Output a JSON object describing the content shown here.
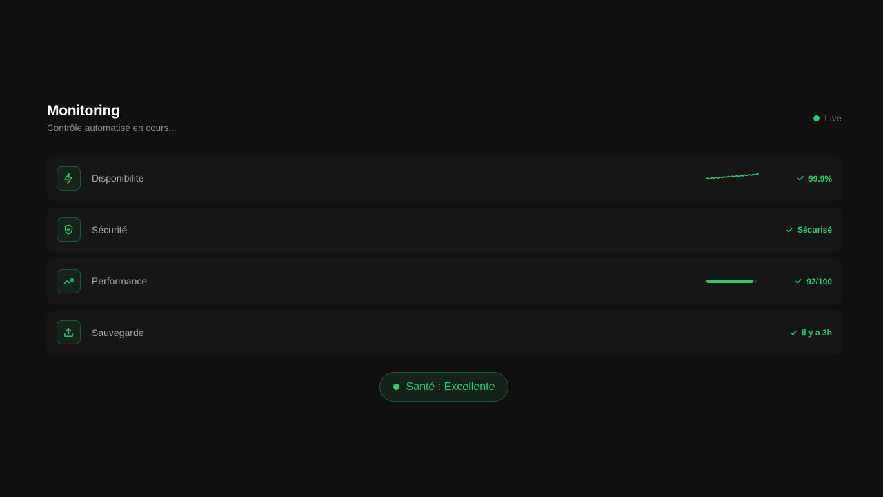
{
  "header": {
    "title": "Monitoring",
    "subtitle": "Contrôle automatisé en cours...",
    "live_label": "Live"
  },
  "rows": [
    {
      "icon": "lightning-icon",
      "label": "Disponibilité",
      "status": "99.9%",
      "indicator": "sparkline"
    },
    {
      "icon": "shield-check-icon",
      "label": "Sécurité",
      "status": "Sécurisé",
      "indicator": "none"
    },
    {
      "icon": "trending-up-icon",
      "label": "Performance",
      "status": "92/100",
      "indicator": "progress",
      "progress_percent": 92
    },
    {
      "icon": "upload-icon",
      "label": "Sauvegarde",
      "status": "Il y a 3h",
      "indicator": "none"
    }
  ],
  "health": {
    "label": "Santé : Excellente"
  },
  "colors": {
    "background": "#111011",
    "row_background": "#171617",
    "accent": "#22d36b",
    "muted_text": "#8a8a8a"
  }
}
